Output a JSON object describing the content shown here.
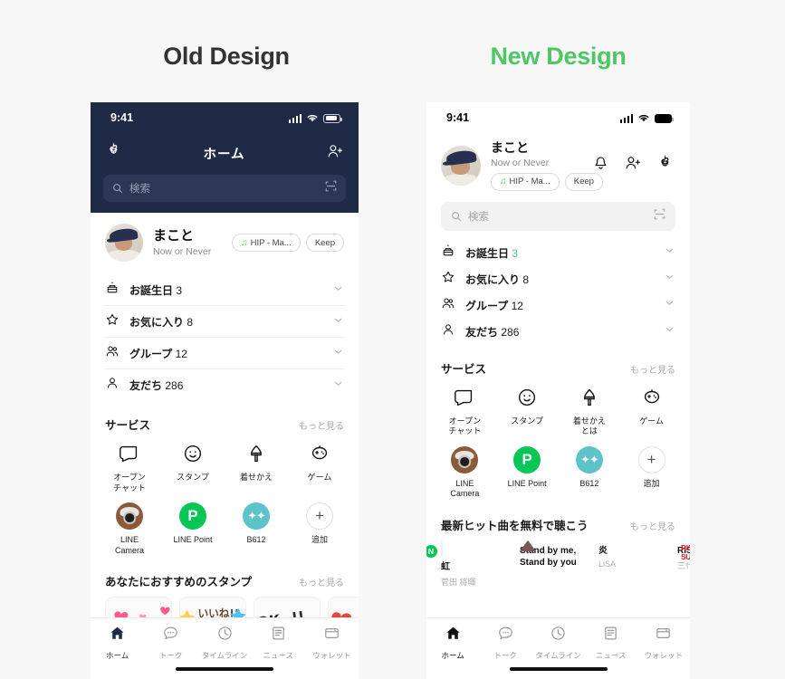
{
  "headings": {
    "old": "Old Design",
    "new": "New Design"
  },
  "colors": {
    "brand_green": "#4cc764",
    "line_green": "#06c755",
    "old_header_navy": "#1f2a47",
    "muted_text": "#a8a8a8"
  },
  "status_bar": {
    "time": "9:41"
  },
  "old": {
    "nav_title": "ホーム",
    "icons": {
      "left": "gear-icon",
      "right": "add-friend-icon"
    },
    "search": {
      "placeholder": "検索",
      "scan": "qr-scan-icon"
    },
    "profile": {
      "name": "まこと",
      "status": "Now or Never",
      "pills": [
        {
          "icon": "music-note-icon",
          "label": "HIP - Ma..."
        },
        {
          "icon": "",
          "label": "Keep"
        }
      ]
    },
    "rows": [
      {
        "icon": "birthday-cake-icon",
        "label": "お誕生日",
        "count": "3",
        "count_green": false
      },
      {
        "icon": "star-icon",
        "label": "お気に入り",
        "count": "8",
        "count_green": false
      },
      {
        "icon": "group-icon",
        "label": "グループ",
        "count": "12",
        "count_green": false
      },
      {
        "icon": "person-icon",
        "label": "友だち",
        "count": "286",
        "count_green": false
      }
    ],
    "services": {
      "title": "サービス",
      "more": "もっと見る",
      "items": [
        {
          "icon": "openchat-icon",
          "label": "オープン\nチャット"
        },
        {
          "icon": "smiley-sticker-icon",
          "label": "スタンプ"
        },
        {
          "icon": "theme-brush-icon",
          "label": "着せかえ"
        },
        {
          "icon": "game-robot-icon",
          "label": "ゲーム"
        },
        {
          "icon": "line-camera-icon",
          "label": "LINE\nCamera"
        },
        {
          "icon": "line-point-icon",
          "label": "LINE Point"
        },
        {
          "icon": "b612-icon",
          "label": "B612"
        },
        {
          "icon": "plus-icon",
          "label": "追加"
        }
      ]
    },
    "stickers": {
      "title": "あなたにおすすめのスタンプ",
      "more": "もっと見る",
      "items": [
        {
          "name": "cony-brown-hearts-sticker"
        },
        {
          "name": "brown-cony-iine-sticker"
        },
        {
          "name": "sally-ok-sticker"
        },
        {
          "name": "colorful-hearts-sticker"
        }
      ]
    },
    "tabs": [
      {
        "icon": "home-icon",
        "label": "ホーム",
        "active": true
      },
      {
        "icon": "chat-icon",
        "label": "トーク",
        "active": false
      },
      {
        "icon": "clock-timeline-icon",
        "label": "タイムライン",
        "active": false
      },
      {
        "icon": "news-icon",
        "label": "ニュース",
        "active": false
      },
      {
        "icon": "wallet-icon",
        "label": "ウォレット",
        "active": false
      }
    ]
  },
  "new": {
    "profile": {
      "name": "まこと",
      "status": "Now or Never",
      "pills": [
        {
          "icon": "music-note-icon",
          "label": "HIP - Ma..."
        },
        {
          "icon": "",
          "label": "Keep"
        }
      ]
    },
    "actions": [
      {
        "icon": "bell-icon",
        "name": "notifications-button"
      },
      {
        "icon": "add-friend-icon",
        "name": "add-friend-button"
      },
      {
        "icon": "gear-icon",
        "name": "settings-button"
      }
    ],
    "search": {
      "placeholder": "検索",
      "scan": "qr-scan-icon"
    },
    "rows": [
      {
        "icon": "birthday-cake-icon",
        "label": "お誕生日",
        "count": "3",
        "count_green": true
      },
      {
        "icon": "star-icon",
        "label": "お気に入り",
        "count": "8",
        "count_green": false
      },
      {
        "icon": "group-icon",
        "label": "グループ",
        "count": "12",
        "count_green": false
      },
      {
        "icon": "person-icon",
        "label": "友だち",
        "count": "286",
        "count_green": false
      }
    ],
    "services": {
      "title": "サービス",
      "more": "もっと見る",
      "items": [
        {
          "icon": "openchat-icon",
          "label": "オープン\nチャット"
        },
        {
          "icon": "smiley-sticker-icon",
          "label": "スタンプ"
        },
        {
          "icon": "theme-brush-icon",
          "label": "着せかえ\nとは"
        },
        {
          "icon": "game-robot-icon",
          "label": "ゲーム"
        },
        {
          "icon": "line-camera-icon",
          "label": "LINE\nCamera"
        },
        {
          "icon": "line-point-icon",
          "label": "LINE Point"
        },
        {
          "icon": "b612-icon",
          "label": "B612"
        },
        {
          "icon": "plus-icon",
          "label": "追加"
        }
      ]
    },
    "music": {
      "title": "最新ヒット曲を無料で聴こう",
      "more": "もっと見る",
      "items": [
        {
          "title": "虹",
          "artist": "菅田 将暉",
          "badge": "N",
          "art": "rainbow"
        },
        {
          "title": "Stand by me,\nStand by you",
          "artist": "",
          "badge": "",
          "art": "pink"
        },
        {
          "title": "炎",
          "artist": "LiSA",
          "badge": "",
          "art": "photo"
        },
        {
          "title": "RISING SU",
          "artist": "三代目 J So",
          "badge": "",
          "art": "red"
        }
      ]
    },
    "tabs": [
      {
        "icon": "home-icon",
        "label": "ホーム",
        "active": true
      },
      {
        "icon": "chat-icon",
        "label": "トーク",
        "active": false
      },
      {
        "icon": "clock-timeline-icon",
        "label": "タイムライン",
        "active": false
      },
      {
        "icon": "news-icon",
        "label": "ニュース",
        "active": false
      },
      {
        "icon": "wallet-icon",
        "label": "ウォレット",
        "active": false
      }
    ]
  }
}
